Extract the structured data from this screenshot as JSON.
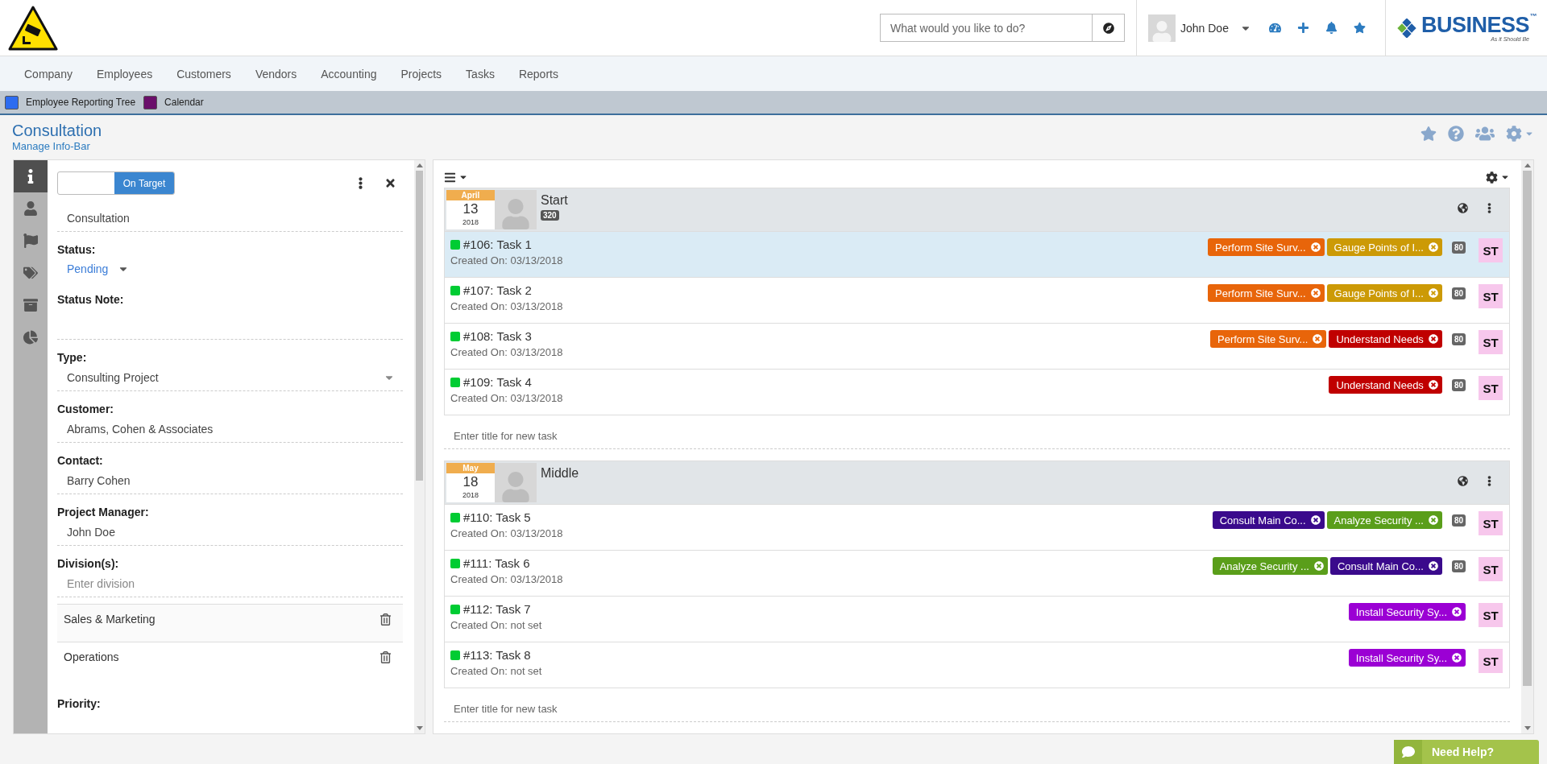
{
  "header": {
    "search": {
      "placeholder": "What would you like to do?"
    },
    "user": {
      "name": "John Doe"
    },
    "brand": {
      "name": "BUSINESS",
      "trademark": "™",
      "tagline": "As it Should Be"
    }
  },
  "nav": [
    "Company",
    "Employees",
    "Customers",
    "Vendors",
    "Accounting",
    "Projects",
    "Tasks",
    "Reports"
  ],
  "quick_links": [
    {
      "label": "Employee Reporting Tree",
      "color": "#2d6cf0"
    },
    {
      "label": "Calendar",
      "color": "#6a0f6a"
    }
  ],
  "page": {
    "title": "Consultation",
    "subtitle_link": "Manage Info-Bar"
  },
  "info_panel": {
    "tabs": [
      {
        "kind": "info",
        "selected": true
      },
      {
        "kind": "person",
        "selected": false
      },
      {
        "kind": "flag",
        "selected": false
      },
      {
        "kind": "tags",
        "selected": false
      },
      {
        "kind": "archive",
        "selected": false
      },
      {
        "kind": "chart",
        "selected": false
      }
    ],
    "toggle": {
      "label": "On Target"
    },
    "name_field": "Consultation",
    "fields": [
      {
        "kind": "dropdown",
        "label": "Status:",
        "value": "Pending"
      },
      {
        "kind": "note",
        "label": "Status Note:"
      },
      {
        "kind": "select",
        "label": "Type:",
        "value": "Consulting Project"
      },
      {
        "kind": "text",
        "label": "Customer:",
        "value": "Abrams, Cohen & Associates"
      },
      {
        "kind": "text",
        "label": "Contact:",
        "value": "Barry Cohen"
      },
      {
        "kind": "text",
        "label": "Project Manager:",
        "value": "John Doe"
      },
      {
        "kind": "list",
        "label": "Division(s):",
        "placeholder": "Enter division",
        "items": [
          "Sales & Marketing",
          "Operations"
        ]
      },
      {
        "kind": "heading",
        "label": "Priority:"
      }
    ]
  },
  "task_groups": [
    {
      "month": "April",
      "day": "13",
      "year": "2018",
      "title": "Start",
      "count": "320",
      "new_task_placeholder": "Enter title for new task",
      "tasks": [
        {
          "title": "#106: Task 1",
          "created": "Created On: 03/13/2018",
          "selected": true,
          "tags": [
            {
              "label": "Perform Site Surv...",
              "color": "#e8650a"
            },
            {
              "label": "Gauge Points of I...",
              "color": "#cc9a06"
            }
          ],
          "points": "80",
          "assignee": "ST"
        },
        {
          "title": "#107: Task 2",
          "created": "Created On: 03/13/2018",
          "selected": false,
          "tags": [
            {
              "label": "Perform Site Surv...",
              "color": "#e8650a"
            },
            {
              "label": "Gauge Points of I...",
              "color": "#cc9a06"
            }
          ],
          "points": "80",
          "assignee": "ST"
        },
        {
          "title": "#108: Task 3",
          "created": "Created On: 03/13/2018",
          "selected": false,
          "tags": [
            {
              "label": "Perform Site Surv...",
              "color": "#e8650a"
            },
            {
              "label": "Understand Needs",
              "color": "#c00000"
            }
          ],
          "points": "80",
          "assignee": "ST"
        },
        {
          "title": "#109: Task 4",
          "created": "Created On: 03/13/2018",
          "selected": false,
          "tags": [
            {
              "label": "Understand Needs",
              "color": "#c00000"
            }
          ],
          "points": "80",
          "assignee": "ST"
        }
      ]
    },
    {
      "month": "May",
      "day": "18",
      "year": "2018",
      "title": "Middle",
      "new_task_placeholder": "Enter title for new task",
      "tasks": [
        {
          "title": "#110: Task 5",
          "created": "Created On: 03/13/2018",
          "selected": false,
          "tags": [
            {
              "label": "Consult Main Co...",
              "color": "#3a0a8c"
            },
            {
              "label": "Analyze Security ...",
              "color": "#5a9e1a"
            }
          ],
          "points": "80",
          "assignee": "ST"
        },
        {
          "title": "#111: Task 6",
          "created": "Created On: 03/13/2018",
          "selected": false,
          "tags": [
            {
              "label": "Analyze Security ...",
              "color": "#5a9e1a"
            },
            {
              "label": "Consult Main Co...",
              "color": "#3a0a8c"
            }
          ],
          "points": "80",
          "assignee": "ST"
        },
        {
          "title": "#112: Task 7",
          "created": "Created On: not set",
          "selected": false,
          "tags": [
            {
              "label": "Install Security Sy...",
              "color": "#9b00d4"
            }
          ],
          "assignee": "ST"
        },
        {
          "title": "#113: Task 8",
          "created": "Created On: not set",
          "selected": false,
          "tags": [
            {
              "label": "Install Security Sy...",
              "color": "#9b00d4"
            }
          ],
          "assignee": "ST"
        }
      ]
    }
  ],
  "help_button": "Need Help?"
}
